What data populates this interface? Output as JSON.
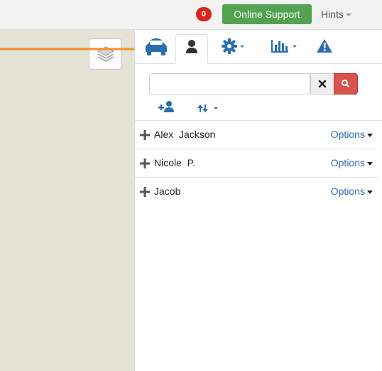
{
  "header": {
    "notification_count": "0",
    "support_label": "Online Support",
    "hints_label": "Hints"
  },
  "tabs": [
    {
      "name": "vehicles",
      "icon": "car-icon",
      "active": false
    },
    {
      "name": "users",
      "icon": "user-icon",
      "active": true
    },
    {
      "name": "settings",
      "icon": "gear-icon",
      "active": false
    },
    {
      "name": "reports",
      "icon": "bar-chart-icon",
      "active": false
    },
    {
      "name": "alerts",
      "icon": "warning-icon",
      "active": false
    }
  ],
  "search": {
    "value": "",
    "placeholder": ""
  },
  "users": [
    {
      "name": "Alex  Jackson",
      "options_label": "Options"
    },
    {
      "name": "Nicole  P.",
      "options_label": "Options"
    },
    {
      "name": "Jacob",
      "options_label": "Options"
    }
  ],
  "colors": {
    "accent": "#2a6db2",
    "support_green": "#51a351",
    "badge_red": "#d9231b",
    "search_red": "#d9534f",
    "map_beige": "#e5e2d6",
    "arrow_orange": "#f0922a"
  }
}
